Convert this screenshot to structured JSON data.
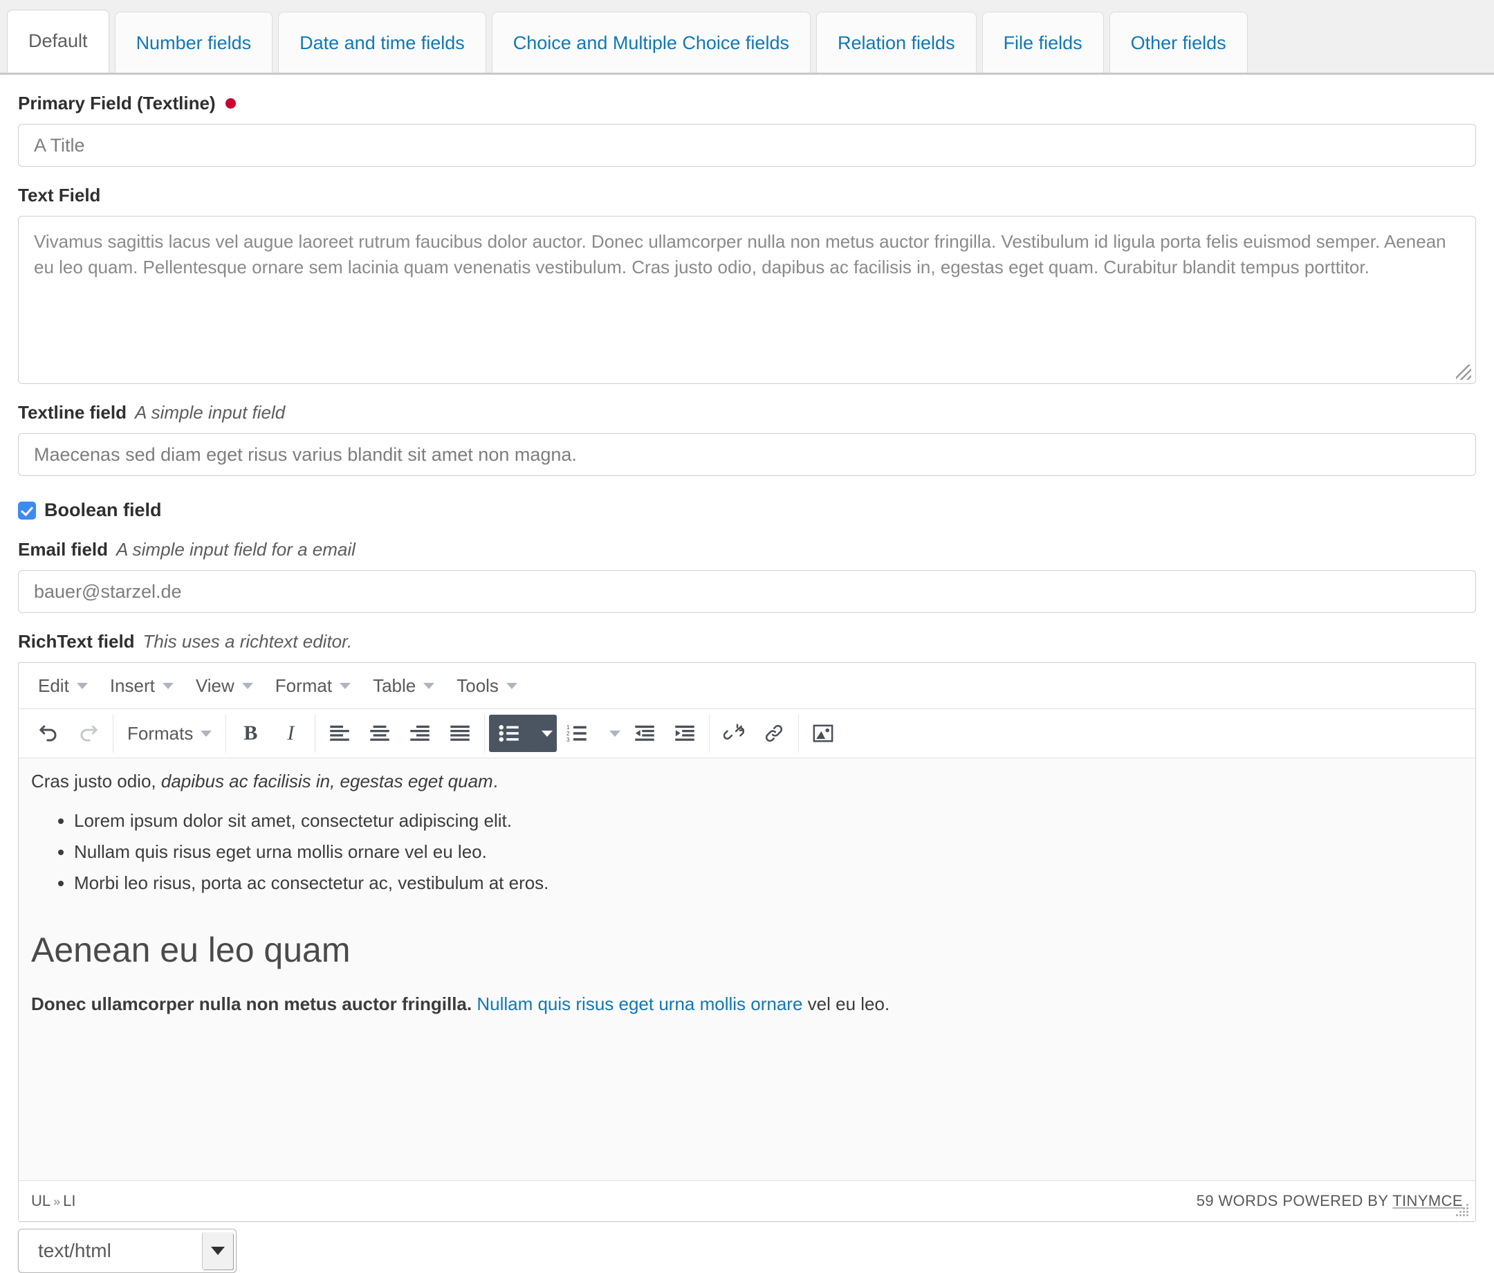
{
  "tabs": [
    {
      "label": "Default",
      "active": true
    },
    {
      "label": "Number fields",
      "active": false
    },
    {
      "label": "Date and time fields",
      "active": false
    },
    {
      "label": "Choice and Multiple Choice fields",
      "active": false
    },
    {
      "label": "Relation fields",
      "active": false
    },
    {
      "label": "File fields",
      "active": false
    },
    {
      "label": "Other fields",
      "active": false
    }
  ],
  "primary_field": {
    "label": "Primary Field (Textline)",
    "required_marker": "required-dot",
    "value": "A Title"
  },
  "text_field": {
    "label": "Text Field",
    "value": "Vivamus sagittis lacus vel augue laoreet rutrum faucibus dolor auctor. Donec ullamcorper nulla non metus auctor fringilla. Vestibulum id ligula porta felis euismod semper. Aenean eu leo quam. Pellentesque ornare sem lacinia quam venenatis vestibulum. Cras justo odio, dapibus ac facilisis in, egestas eget quam. Curabitur blandit tempus porttitor."
  },
  "textline_field": {
    "label": "Textline field",
    "hint": "A simple input field",
    "value": "Maecenas sed diam eget risus varius blandit sit amet non magna."
  },
  "boolean_field": {
    "label": "Boolean field",
    "checked": true
  },
  "email_field": {
    "label": "Email field",
    "hint": "A simple input field for a email",
    "value": "bauer@starzel.de"
  },
  "richtext_field": {
    "label": "RichText field",
    "hint": "This uses a richtext editor.",
    "menubar": [
      "Edit",
      "Insert",
      "View",
      "Format",
      "Table",
      "Tools"
    ],
    "toolbar": {
      "undo": "undo-icon",
      "redo": "redo-icon",
      "formats_label": "Formats",
      "bold": "B",
      "italic": "I",
      "align_left": "align-left-icon",
      "align_center": "align-center-icon",
      "align_right": "align-right-icon",
      "align_justify": "align-justify-icon",
      "bullist": "bullet-list-icon",
      "numlist": "numbered-list-icon",
      "outdent": "outdent-icon",
      "indent": "indent-icon",
      "unlink": "unlink-icon",
      "link": "link-icon",
      "image": "image-icon"
    },
    "content": {
      "lead_plain_1": "Cras justo odio, ",
      "lead_italic": "dapibus ac facilisis in, egestas eget quam",
      "lead_plain_2": ".",
      "bullets": [
        "Lorem ipsum dolor sit amet, consectetur adipiscing elit.",
        "Nullam quis risus eget urna mollis ornare vel eu leo.",
        "Morbi leo risus, porta ac consectetur ac, vestibulum at eros."
      ],
      "heading": "Aenean eu leo quam",
      "final_strong": "Donec ullamcorper nulla non metus auctor fringilla. ",
      "final_link": "Nullam quis risus eget urna mollis ornare",
      "final_tail": " vel eu leo."
    },
    "statusbar": {
      "path_first": "UL",
      "path_sep": "»",
      "path_last": "LI",
      "branding_count": "59 WORDS POWERED BY ",
      "branding_link": "TINYMCE"
    }
  },
  "mimetype_select": {
    "value": "text/html"
  },
  "colors": {
    "link": "#1178b5",
    "required": "#cc0033",
    "checkbox": "#3b8bf0",
    "toolbar_active_bg": "#4b5562"
  }
}
